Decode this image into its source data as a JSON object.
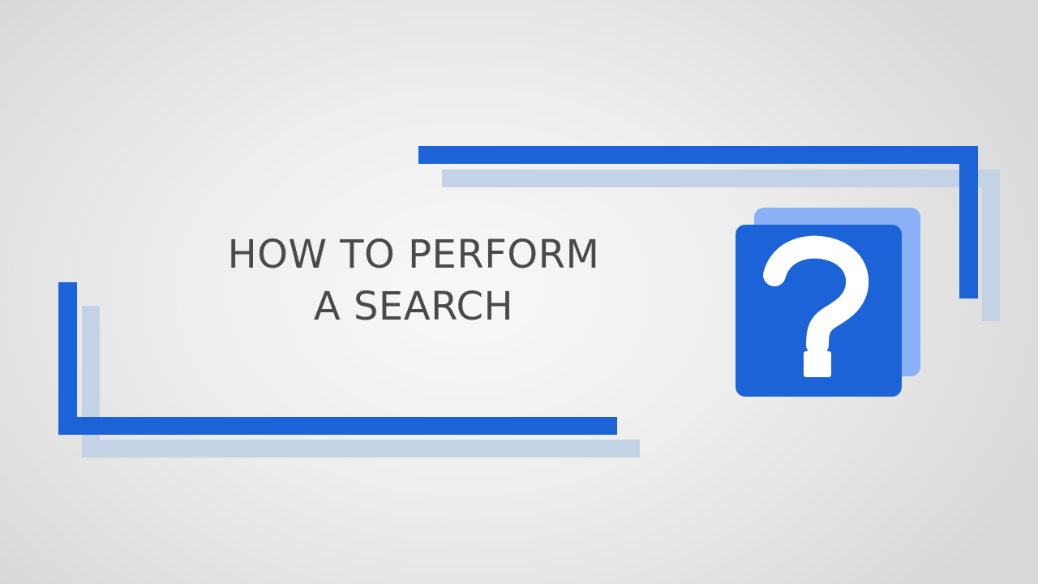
{
  "slide": {
    "title_line1": "HOW TO PERFORM",
    "title_line2": "A SEARCH"
  },
  "icons": {
    "help": "question-mark-icon"
  },
  "colors": {
    "primary": "#1c63d8",
    "shadow": "#c4d2e6",
    "light_square": "#8ab1f5",
    "icon_glyph": "#ffffff",
    "title_text": "#4a4a4a"
  }
}
